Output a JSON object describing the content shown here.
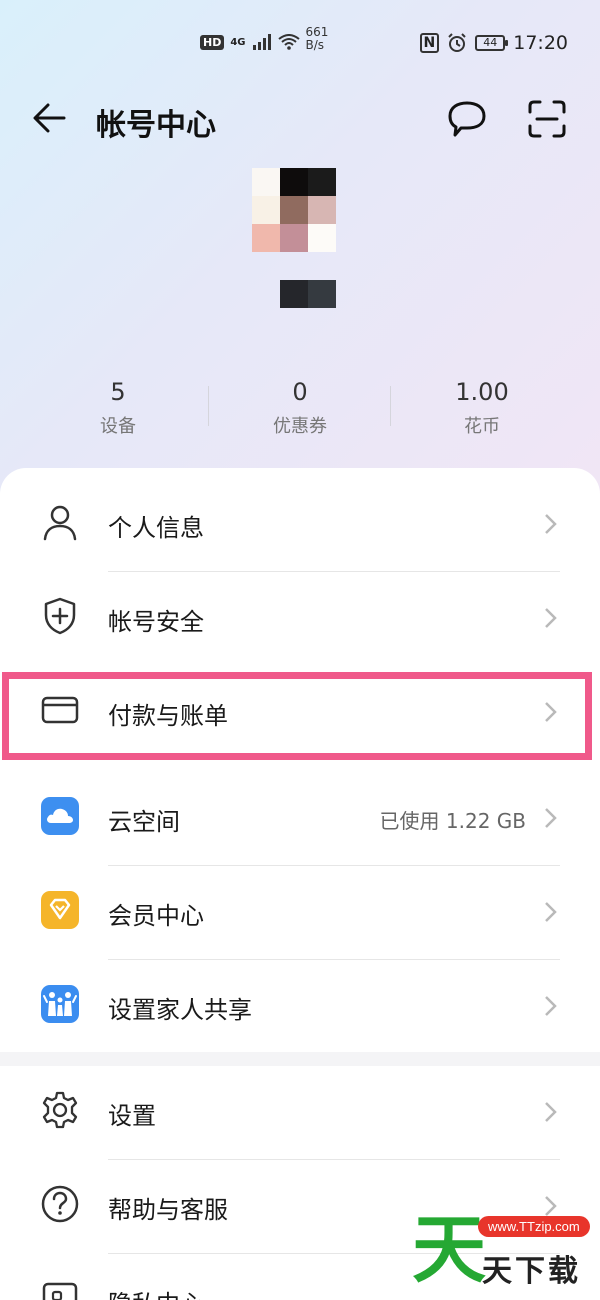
{
  "status_bar": {
    "hd": "HD",
    "network": "4G",
    "speed_value": "661",
    "speed_unit": "B/s",
    "nfc": "N",
    "battery": "44",
    "time": "17:20"
  },
  "header": {
    "title": "帐号中心",
    "back_icon": "arrow-left-icon",
    "message_icon": "chat-bubble-icon",
    "scan_icon": "scan-icon"
  },
  "stats": [
    {
      "value": "5",
      "label": "设备"
    },
    {
      "value": "0",
      "label": "优惠券"
    },
    {
      "value": "1.00",
      "label": "花币"
    }
  ],
  "menu": [
    {
      "label": "个人信息",
      "icon": "person-icon",
      "value": ""
    },
    {
      "label": "帐号安全",
      "icon": "shield-icon",
      "value": ""
    },
    {
      "label": "付款与账单",
      "icon": "card-icon",
      "value": ""
    },
    {
      "label": "云空间",
      "icon": "cloud-icon",
      "value": "已使用 1.22 GB"
    },
    {
      "label": "会员中心",
      "icon": "diamond-icon",
      "value": ""
    },
    {
      "label": "设置家人共享",
      "icon": "family-icon",
      "value": ""
    }
  ],
  "menu2": [
    {
      "label": "设置",
      "icon": "gear-icon"
    },
    {
      "label": "帮助与客服",
      "icon": "help-icon"
    },
    {
      "label": "隐私中心",
      "icon": "privacy-icon"
    }
  ],
  "watermark": {
    "big": "天",
    "url": "www.TTzip.com",
    "small": "天下载"
  },
  "colors": {
    "highlight": "#f0598a",
    "cloud": "#3d8ff0",
    "vip": "#f5b52a",
    "family": "#3b8df0"
  }
}
